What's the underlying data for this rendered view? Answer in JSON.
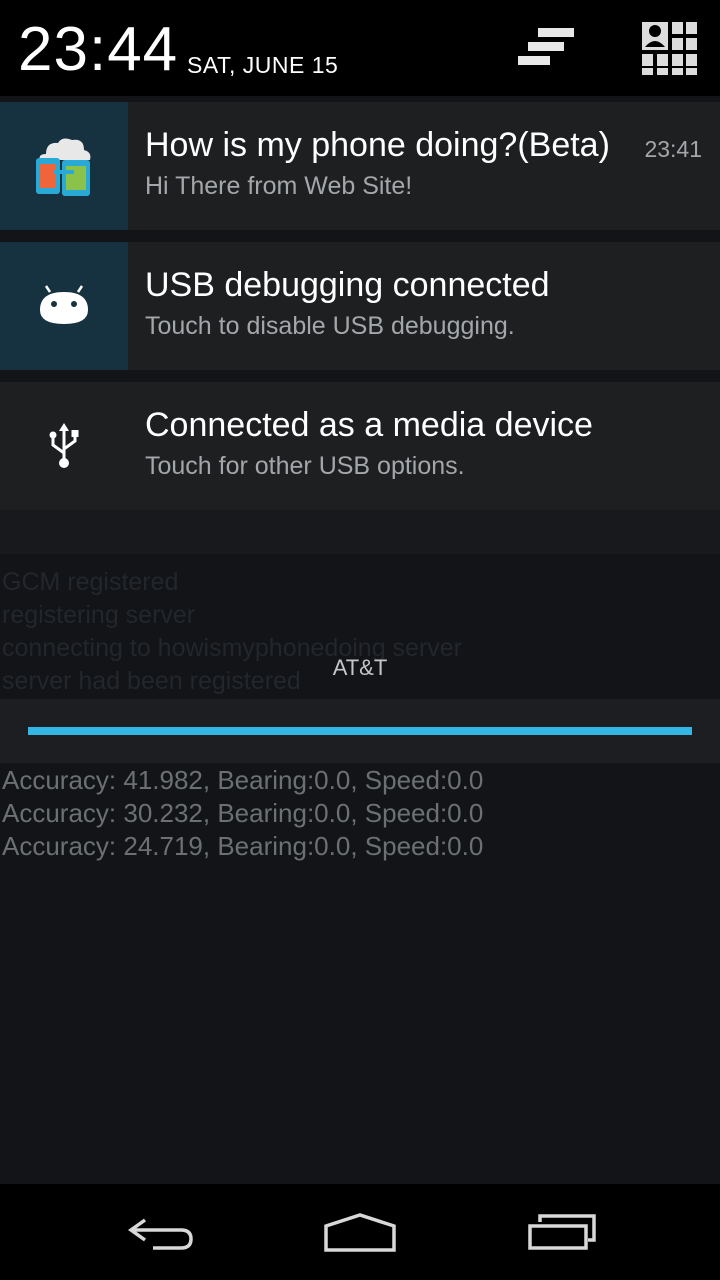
{
  "status": {
    "time": "23:44",
    "date": "SAT, JUNE 15"
  },
  "header_icons": {
    "clear": "clear-all-icon",
    "settings": "quick-settings-icon"
  },
  "notifications": [
    {
      "icon": "phone-status-app-icon",
      "title": "How is my phone doing?(Beta)",
      "text": "Hi There from Web Site!",
      "time": "23:41"
    },
    {
      "icon": "android-debug-icon",
      "title": "USB debugging connected",
      "text": "Touch to disable USB debugging."
    },
    {
      "icon": "usb-icon",
      "title": "Connected as a media device",
      "text": "Touch for other USB options."
    }
  ],
  "carrier": "AT&T",
  "background_app": {
    "log": [
      "GCM registered",
      "registering server",
      "connecting to howismyphonedoing server",
      "server had been registered"
    ],
    "accuracy": [
      "Accuracy: 41.982, Bearing:0.0, Speed:0.0",
      "Accuracy: 30.232, Bearing:0.0, Speed:0.0",
      "Accuracy: 24.719, Bearing:0.0, Speed:0.0"
    ]
  },
  "nav": {
    "back": "back-icon",
    "home": "home-icon",
    "recents": "recents-icon"
  },
  "colors": {
    "accent": "#33b5e5",
    "icon_bg": "#16313f"
  }
}
